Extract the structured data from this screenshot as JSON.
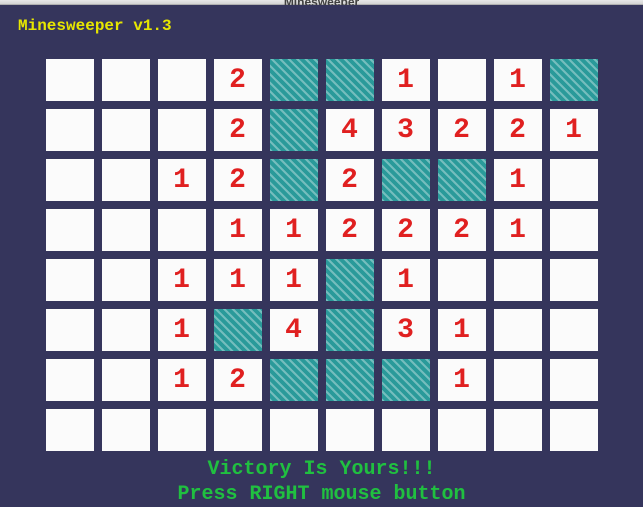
{
  "window": {
    "title": "Minesweeper",
    "minimize": "–",
    "close": "×"
  },
  "game": {
    "version": "Minesweeper v1.3",
    "victory_line1": "Victory Is Yours!!!",
    "victory_line2": "Press RIGHT mouse button",
    "rows": 8,
    "cols": 10,
    "grid": [
      [
        "",
        "",
        "",
        "2",
        "M",
        "M",
        "1",
        "",
        "1",
        "M"
      ],
      [
        "",
        "",
        "",
        "2",
        "M",
        "4",
        "3",
        "2",
        "2",
        "1"
      ],
      [
        "",
        "",
        "1",
        "2",
        "M",
        "2",
        "M",
        "M",
        "1",
        ""
      ],
      [
        "",
        "",
        "",
        "1",
        "1",
        "2",
        "2",
        "2",
        "1",
        ""
      ],
      [
        "",
        "",
        "1",
        "1",
        "1",
        "M",
        "1",
        "",
        "",
        ""
      ],
      [
        "",
        "",
        "1",
        "M",
        "4",
        "M",
        "3",
        "1",
        "",
        ""
      ],
      [
        "",
        "",
        "1",
        "2",
        "M",
        "M",
        "M",
        "1",
        "",
        ""
      ],
      [
        "",
        "",
        "",
        "",
        "",
        "",
        "",
        "",
        "",
        ""
      ]
    ]
  }
}
